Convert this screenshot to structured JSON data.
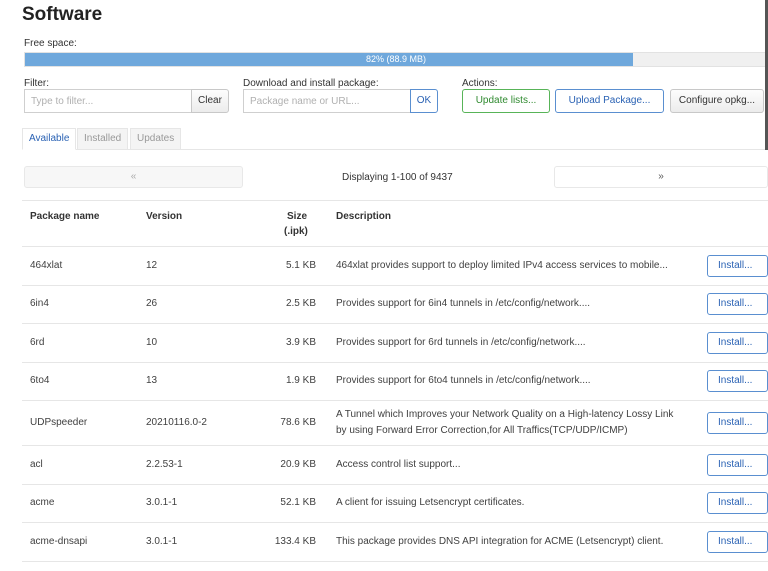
{
  "page": {
    "title": "Software"
  },
  "free_space": {
    "label": "Free space:",
    "text": "82% (88.9 MB)",
    "fraction": 0.82
  },
  "filter": {
    "label": "Filter:",
    "placeholder": "Type to filter...",
    "clear_label": "Clear"
  },
  "download": {
    "label": "Download and install package:",
    "placeholder": "Package name or URL...",
    "ok_label": "OK"
  },
  "actions": {
    "label": "Actions:",
    "update_label": "Update lists...",
    "upload_label": "Upload Package...",
    "configure_label": "Configure opkg..."
  },
  "tabs": [
    {
      "label": "Available"
    },
    {
      "label": "Installed"
    },
    {
      "label": "Updates"
    }
  ],
  "pager": {
    "prev": "«",
    "next": "»",
    "text": "Displaying 1-100 of 9437"
  },
  "table": {
    "headers": {
      "name": "Package name",
      "version": "Version",
      "size1": "Size",
      "size2": "(.ipk)",
      "description": "Description"
    },
    "install_label": "Install...",
    "rows": [
      {
        "name": "464xlat",
        "version": "12",
        "size": "5.1 KB",
        "desc": "464xlat provides support to deploy limited IPv4 access services to mobile..."
      },
      {
        "name": "6in4",
        "version": "26",
        "size": "2.5 KB",
        "desc": "Provides support for 6in4 tunnels in /etc/config/network...."
      },
      {
        "name": "6rd",
        "version": "10",
        "size": "3.9 KB",
        "desc": "Provides support for 6rd tunnels in /etc/config/network...."
      },
      {
        "name": "6to4",
        "version": "13",
        "size": "1.9 KB",
        "desc": "Provides support for 6to4 tunnels in /etc/config/network...."
      },
      {
        "name": "UDPspeeder",
        "version": "20210116.0-2",
        "size": "78.6 KB",
        "desc": "A Tunnel which Improves your Network Quality on a High-latency Lossy Link",
        "desc2": "by using Forward Error Correction,for All Traffics(TCP/UDP/ICMP)"
      },
      {
        "name": "acl",
        "version": "2.2.53-1",
        "size": "20.9 KB",
        "desc": "Access control list support..."
      },
      {
        "name": "acme",
        "version": "3.0.1-1",
        "size": "52.1 KB",
        "desc": "A client for issuing Letsencrypt certificates."
      },
      {
        "name": "acme-dnsapi",
        "version": "3.0.1-1",
        "size": "133.4 KB",
        "desc": "This package provides DNS API integration for ACME (Letsencrypt) client."
      }
    ]
  }
}
